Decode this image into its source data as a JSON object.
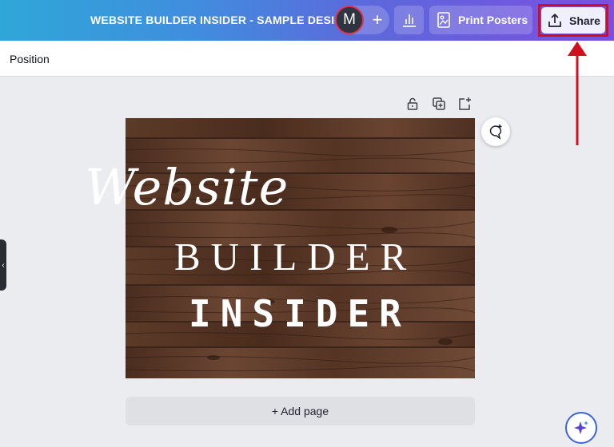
{
  "topbar": {
    "doc_title": "WEBSITE BUILDER INSIDER - SAMPLE DESIGN",
    "avatar_initial": "M",
    "add_collaborator": "+",
    "print_label": "Print Posters",
    "share_label": "Share"
  },
  "subbar": {
    "position_label": "Position"
  },
  "design": {
    "line1": "Website",
    "line2": "BUILDER",
    "line3": "INSIDER"
  },
  "add_page_label": "+ Add page",
  "side_toggle": "‹",
  "colors": {
    "highlight": "#d20f1d",
    "wood_dark": "#3b2419",
    "wood_light": "#6b4633"
  },
  "icons": {
    "insights": "bar-chart-icon",
    "print": "print-poster-icon",
    "share": "upload-share-icon",
    "lock": "lock-icon",
    "duplicate": "duplicate-icon",
    "add_page": "add-page-icon",
    "comment": "add-comment-icon",
    "magic": "magic-sparkle-icon"
  }
}
